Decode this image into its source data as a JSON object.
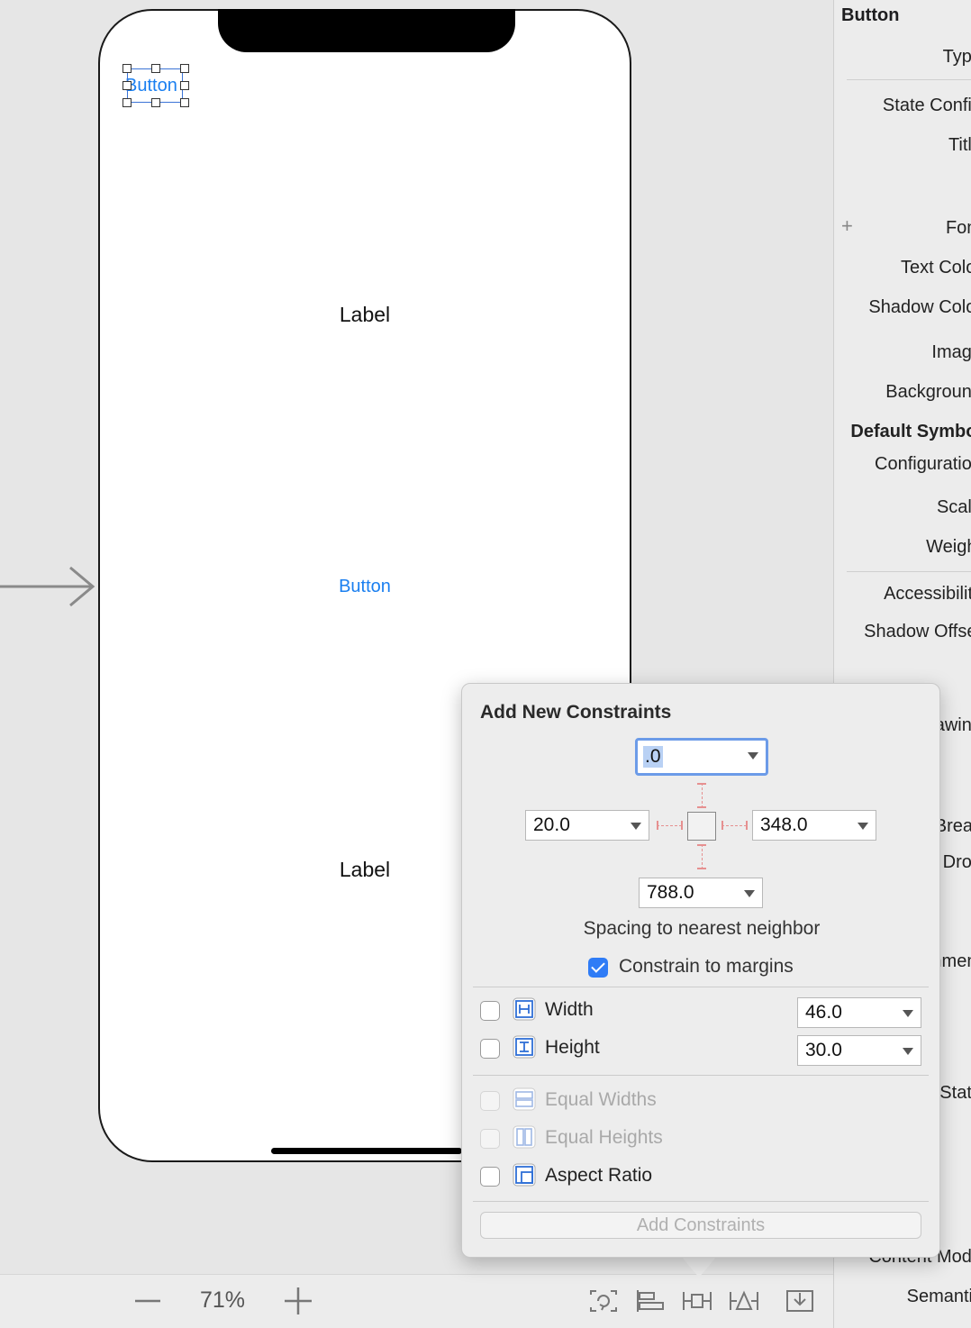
{
  "canvas": {
    "label_top": "Label",
    "button_middle": "Button",
    "label_bottom": "Label",
    "selected_button": "Button"
  },
  "bottom_bar": {
    "zoom_level": "71%"
  },
  "inspector": {
    "title": "Button",
    "rows": [
      {
        "label": "Type"
      },
      {
        "label": "State Config"
      },
      {
        "label": "Title"
      },
      {
        "label": "Font"
      },
      {
        "label": "Text Color"
      },
      {
        "label": "Shadow Color"
      },
      {
        "label": "Image"
      },
      {
        "label": "Background"
      },
      {
        "label": "Default Symbol"
      },
      {
        "label": "Configuration"
      },
      {
        "label": "Scale"
      },
      {
        "label": "Weight"
      },
      {
        "label": "Accessibility"
      },
      {
        "label": "Shadow Offset"
      },
      {
        "label": "Drawing"
      },
      {
        "label": "Line Break"
      },
      {
        "label": "Drop"
      },
      {
        "label": "Alignment"
      },
      {
        "label": "State"
      },
      {
        "label": "Content Mode"
      },
      {
        "label": "Semantic"
      }
    ]
  },
  "popover": {
    "title": "Add New Constraints",
    "top_value": ".0",
    "leading_value": "20.0",
    "trailing_value": "348.0",
    "bottom_value": "788.0",
    "spacing_label": "Spacing to nearest neighbor",
    "constrain_margins_label": "Constrain to margins",
    "constrain_margins_checked": true,
    "width_label": "Width",
    "width_value": "46.0",
    "height_label": "Height",
    "height_value": "30.0",
    "equal_widths_label": "Equal Widths",
    "equal_heights_label": "Equal Heights",
    "aspect_ratio_label": "Aspect Ratio",
    "add_button_label": "Add Constraints"
  },
  "colors": {
    "accent": "#2f7cf6",
    "button_text": "#1a7ff0",
    "strut": "#e69090"
  }
}
